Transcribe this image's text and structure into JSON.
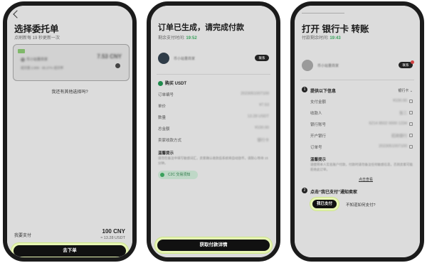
{
  "screen1": {
    "title": "选择委托单",
    "subtitle": "点刷新每 19 秒更新一次",
    "offer": {
      "merchant": "币小站量商家",
      "stats": "成交量 2,999 · 95.27% 成交率",
      "price": "7.53 CNY"
    },
    "other_link": "我还有其他选择吗?",
    "pay_label": "我要支付",
    "pay_amount": "100 CNY",
    "pay_usdt": "≈ 13.28 USDT",
    "cta": "去下单"
  },
  "screen2": {
    "title": "订单已生成，请完成付款",
    "countdown_label": "剩余支付时间:",
    "countdown": "19:52",
    "merchant": "币小站量商家",
    "contact": "联系",
    "section": "购买 USDT",
    "rows": [
      {
        "k": "订单编号",
        "v": "2023051007100"
      },
      {
        "k": "单价",
        "v": "¥7.53"
      },
      {
        "k": "数量",
        "v": "13.28 USDT"
      },
      {
        "k": "总金额",
        "v": "¥100.00"
      },
      {
        "k": "卖家收款方式",
        "v": "银行卡"
      }
    ],
    "note_title": "温馨提示",
    "note_body": "请勿在备注中填写敏感词汇，卖家确认收款后系统将自动放币，请耐心等待 15 分钟。",
    "chip": "C2C 交易须知",
    "cta": "获取付款详情"
  },
  "screen3": {
    "title": "打开 银行卡 转账",
    "countdown_label": "付款剩余时间:",
    "countdown": "19:43",
    "merchant": "币小站量商家",
    "contact": "联系",
    "step1": "提供以下信息",
    "bank_select": "银行卡",
    "rows": [
      {
        "k": "支付金额",
        "v": "¥100.00"
      },
      {
        "k": "收款人",
        "v": "张三"
      },
      {
        "k": "银行账号",
        "v": "6214 8502 0000 1234"
      },
      {
        "k": "开户银行",
        "v": "招商银行"
      },
      {
        "k": "订单号",
        "v": "2023051007100"
      }
    ],
    "note_title": "温馨提示",
    "note_body": "请使用本人实名账户付款，付款时请勿备注任何敏感信息，否则卖家可能拒绝此订单。",
    "more_link": "点击查看",
    "step2": "点击“我已支付”通知卖家",
    "paid_button": "我已支付",
    "howto": "不知道如何支付?"
  }
}
